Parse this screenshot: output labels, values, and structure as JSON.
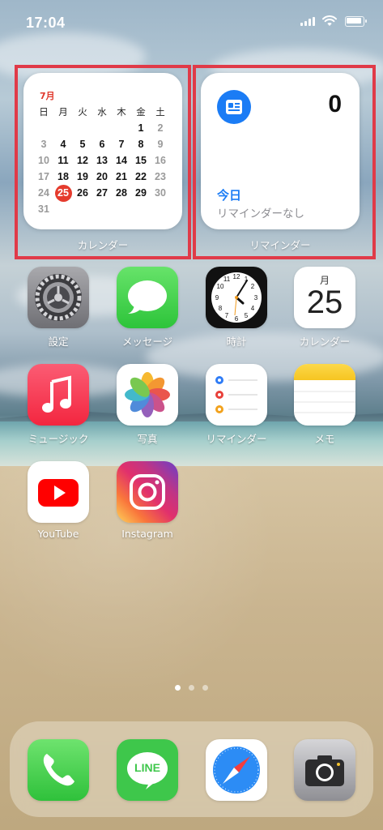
{
  "status_bar": {
    "time": "17:04"
  },
  "calendar_widget": {
    "month": "7月",
    "weekday_headers": [
      "日",
      "月",
      "火",
      "水",
      "木",
      "金",
      "土"
    ],
    "weeks": [
      [
        "",
        "",
        "",
        "",
        "",
        "1",
        "2"
      ],
      [
        "3",
        "4",
        "5",
        "6",
        "7",
        "8",
        "9"
      ],
      [
        "10",
        "11",
        "12",
        "13",
        "14",
        "15",
        "16"
      ],
      [
        "17",
        "18",
        "19",
        "20",
        "21",
        "22",
        "23"
      ],
      [
        "24",
        "25",
        "26",
        "27",
        "28",
        "29",
        "30"
      ],
      [
        "31",
        "",
        "",
        "",
        "",
        "",
        ""
      ]
    ],
    "today": "25",
    "label": "カレンダー"
  },
  "reminders_widget": {
    "count": "0",
    "today_label": "今日",
    "empty_text": "リマインダーなし",
    "label": "リマインダー"
  },
  "apps": [
    {
      "name": "設定",
      "icon": "settings-icon"
    },
    {
      "name": "メッセージ",
      "icon": "messages-icon"
    },
    {
      "name": "時計",
      "icon": "clock-icon"
    },
    {
      "name": "カレンダー",
      "icon": "calendar-icon",
      "day": "25",
      "weekday": "月"
    },
    {
      "name": "ミュージック",
      "icon": "music-icon"
    },
    {
      "name": "写真",
      "icon": "photos-icon"
    },
    {
      "name": "リマインダー",
      "icon": "reminders-icon"
    },
    {
      "name": "メモ",
      "icon": "notes-icon"
    },
    {
      "name": "YouTube",
      "icon": "youtube-icon"
    },
    {
      "name": "Instagram",
      "icon": "instagram-icon"
    }
  ],
  "dock": [
    {
      "icon": "phone-icon"
    },
    {
      "icon": "line-icon",
      "text": "LINE"
    },
    {
      "icon": "safari-icon"
    },
    {
      "icon": "camera-icon"
    }
  ],
  "page_dots": {
    "count": 3,
    "current": 1
  },
  "colors": {
    "highlight": "#e03a48",
    "calendar_red": "#e53b2d",
    "reminder_blue": "#1b7cf5"
  }
}
